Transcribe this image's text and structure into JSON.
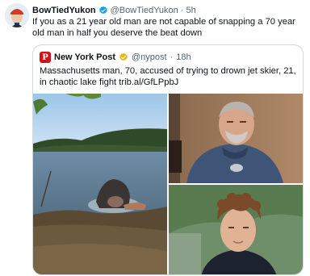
{
  "tweet": {
    "author_name": "BowTiedYukon",
    "author_handle": "@BowTiedYukon",
    "separator": "·",
    "time": "5h",
    "text": "If you as a 21 year old man are not capable of snapping a 70 year old man in half you deserve the beat down"
  },
  "quoted": {
    "logo_letter": "P",
    "author_name": "New York Post",
    "author_handle": "@nypost",
    "separator": "·",
    "time": "18h",
    "text": "Massachusetts man, 70, accused of trying to drown jet skier, 21, in chaotic lake fight trib.al/GfLPpbJ"
  },
  "colors": {
    "verified_blue": "#1d9bf0",
    "verified_gold": "#e2b719",
    "nypost_red": "#d0111b"
  },
  "icons": {
    "verified": "verified-badge-icon",
    "gold_verified": "gold-verified-badge-icon"
  }
}
